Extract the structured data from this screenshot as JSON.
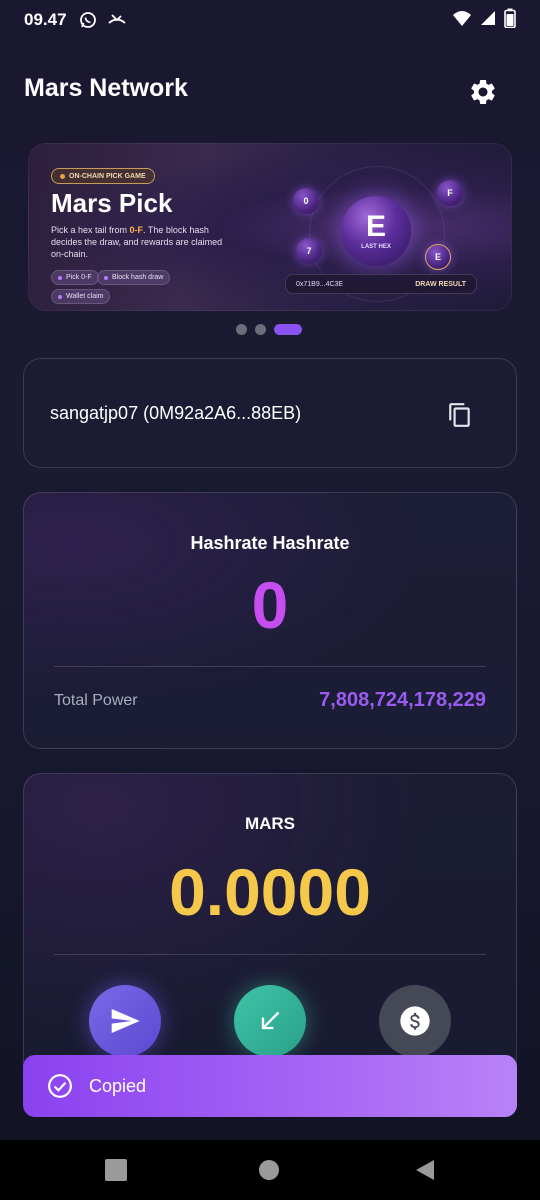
{
  "status_bar": {
    "time": "09.47",
    "icons": [
      "whatsapp-icon",
      "missed-call-icon",
      "wifi-icon",
      "signal-icon",
      "battery-icon"
    ]
  },
  "header": {
    "title": "Mars Network",
    "settings_icon": "gear-icon"
  },
  "banner": {
    "tag": "ON-CHAIN PICK GAME",
    "title": "Mars Pick",
    "desc_pre": "Pick a hex tail from ",
    "desc_highlight": "0-F",
    "desc_post": ". The block hash decides the draw, and rewards are claimed on-chain.",
    "chips": [
      "Pick 0-F",
      "Block hash draw",
      "Wallet claim"
    ],
    "center_letter": "E",
    "center_label": "LAST HEX",
    "orbs": [
      "0",
      "F",
      "7",
      "E"
    ],
    "hash_text": "0x71B9...4C3E",
    "draw_label": "DRAW RESULT",
    "carousel_count": 3,
    "carousel_active": 3
  },
  "wallet": {
    "text": "sangatjp07 (0M92a2A6...88EB)",
    "copy_icon": "copy-icon"
  },
  "hashrate": {
    "title": "Hashrate Hashrate",
    "value": "0",
    "total_power_label": "Total Power",
    "total_power_value": "7,808,724,178,229"
  },
  "mars": {
    "title": "MARS",
    "balance": "0.0000",
    "actions": [
      "send-icon",
      "receive-icon",
      "dollar-icon"
    ]
  },
  "toast": {
    "icon": "check-circle-icon",
    "text": "Copied"
  },
  "nav": {
    "buttons": [
      "recent-apps-icon",
      "home-icon",
      "back-icon"
    ]
  },
  "colors": {
    "hashrate_value": "#c64ef0",
    "total_power": "#9a5cf0",
    "balance": "#f4c84a",
    "toast": "#a766f5"
  }
}
